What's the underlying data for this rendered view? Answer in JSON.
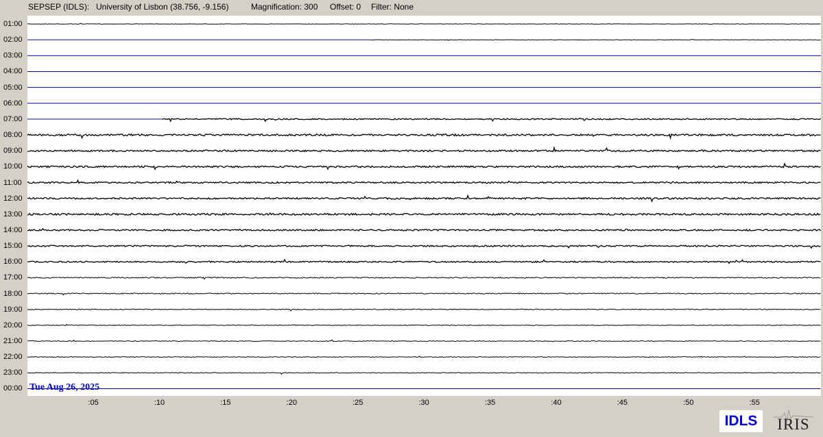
{
  "header": {
    "station": "SEPSEP (IDLS):",
    "site": "University of Lisbon (38.756, -9.156)",
    "magnification": "Magnification: 300",
    "offset": "Offset: 0",
    "filter": "Filter: None"
  },
  "hours": [
    "01:00",
    "02:00",
    "03:00",
    "04:00",
    "05:00",
    "06:00",
    "07:00",
    "08:00",
    "09:00",
    "10:00",
    "11:00",
    "12:00",
    "13:00",
    "14:00",
    "15:00",
    "16:00",
    "17:00",
    "18:00",
    "19:00",
    "20:00",
    "21:00",
    "22:00",
    "23:00",
    "00:00"
  ],
  "minute_ticks": [
    ":05",
    ":10",
    ":15",
    ":20",
    ":25",
    ":30",
    ":35",
    ":40",
    ":45",
    ":50",
    ":55"
  ],
  "date_label": "Tue Aug 26, 2025",
  "logos": {
    "idls": "IDLS",
    "iris": "IRIS"
  },
  "colors": {
    "trace": "#000000",
    "baseline": "#00009c",
    "date": "#0000cc",
    "background": "#d4d0c8"
  },
  "traces": {
    "note_amplitude": "relative noise level per hour row (0 = flat baseline)",
    "noise_level": [
      0.3,
      0.25,
      0,
      0,
      0,
      0,
      0.9,
      1.3,
      1.2,
      1.2,
      1.1,
      1.2,
      1.3,
      1.1,
      1.0,
      1.0,
      0.8,
      0.7,
      0.6,
      0.5,
      0.5,
      0.5,
      0.5,
      0
    ],
    "gap_until_minute": [
      0,
      26,
      60,
      60,
      60,
      60,
      10.2,
      0,
      0,
      0,
      0,
      0,
      0,
      0,
      0,
      0,
      0,
      0,
      0,
      0,
      0,
      0,
      0,
      0
    ]
  }
}
